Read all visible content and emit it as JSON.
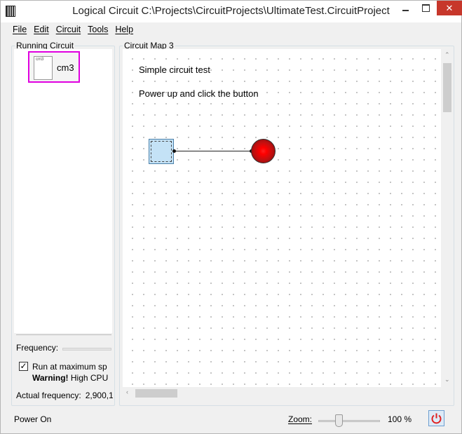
{
  "window": {
    "title": "Logical Circuit C:\\Projects\\CircuitProjects\\UltimateTest.CircuitProject",
    "minimize_icon": "minimize-icon",
    "maximize_icon": "maximize-icon",
    "close_glyph": "✕"
  },
  "menu": {
    "items": [
      {
        "key": "F",
        "rest": "ile"
      },
      {
        "key": "E",
        "rest": "dit"
      },
      {
        "key": "C",
        "rest": "ircuit"
      },
      {
        "key": "T",
        "rest": "ools"
      },
      {
        "key": "H",
        "rest": "elp"
      }
    ]
  },
  "left_panel": {
    "title": "Running Circuit",
    "circuit": {
      "thumb_label": "cm3",
      "label": "cm3"
    },
    "frequency_label": "Frequency:",
    "run_max_label": "Run at maximum sp",
    "run_max_checked": "✓",
    "warning_bold": "Warning!",
    "warning_text": " High CPU",
    "actual_frequency_label": "Actual frequency:",
    "actual_frequency_value": "2,900,1"
  },
  "right_panel": {
    "title": "Circuit Map 3",
    "text1": "Simple circuit test",
    "text2": "Power up and click the button"
  },
  "status": {
    "text": "Power On",
    "zoom_label": "Zoom:",
    "zoom_value": "100 %",
    "zoom_level": 0.3
  },
  "colors": {
    "selection": "#e000e0",
    "led": "#ff0000",
    "button_fill": "#c4e2f6",
    "close": "#c7372b"
  }
}
